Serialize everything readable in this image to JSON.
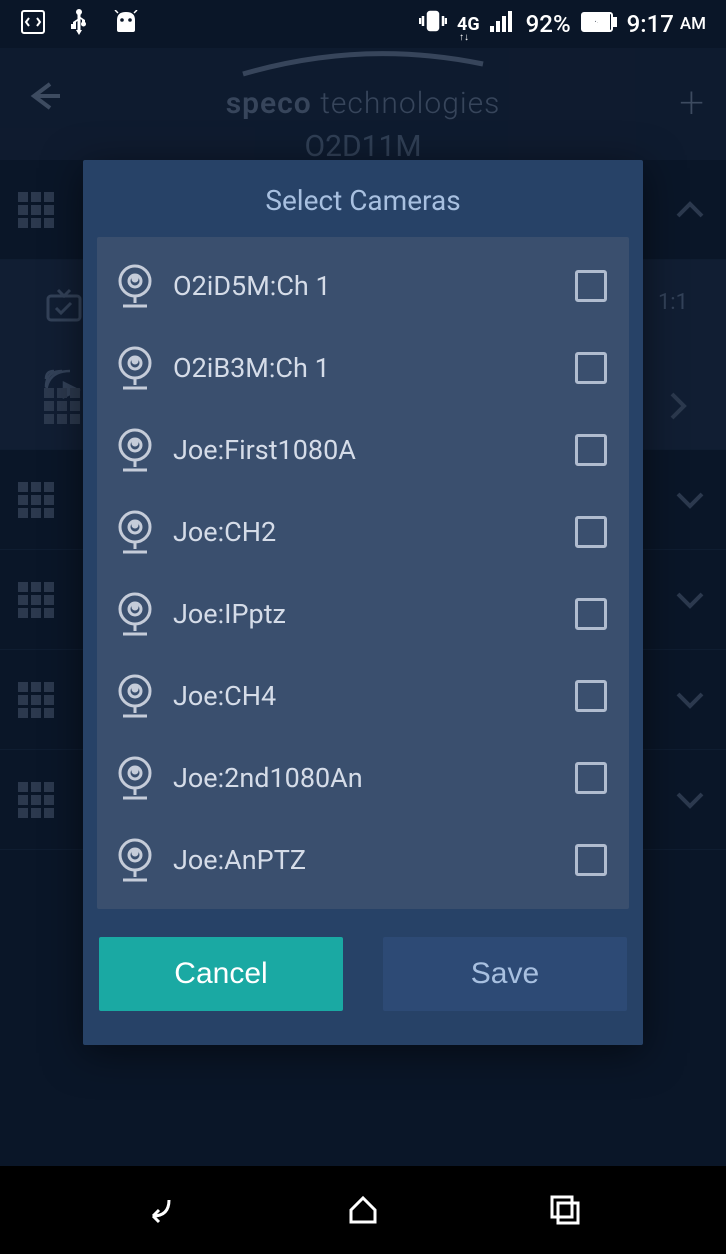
{
  "statusBar": {
    "batteryPercent": "92%",
    "time": "9:17",
    "ampm": "AM",
    "network": "4G"
  },
  "header": {
    "brandPrefix": "speco",
    "brandSuffix": "technologies",
    "model": "O2D11M"
  },
  "bgFeatured": {
    "ratio": "1:1"
  },
  "modal": {
    "title": "Select Cameras",
    "cameras": [
      {
        "label": "O2iD5M:Ch 1",
        "checked": false
      },
      {
        "label": "O2iB3M:Ch 1",
        "checked": false
      },
      {
        "label": "Joe:First1080A",
        "checked": false
      },
      {
        "label": "Joe:CH2",
        "checked": false
      },
      {
        "label": "Joe:IPptz",
        "checked": false
      },
      {
        "label": "Joe:CH4",
        "checked": false
      },
      {
        "label": "Joe:2nd1080An",
        "checked": false
      },
      {
        "label": "Joe:AnPTZ",
        "checked": false
      }
    ],
    "cancelLabel": "Cancel",
    "saveLabel": "Save"
  }
}
